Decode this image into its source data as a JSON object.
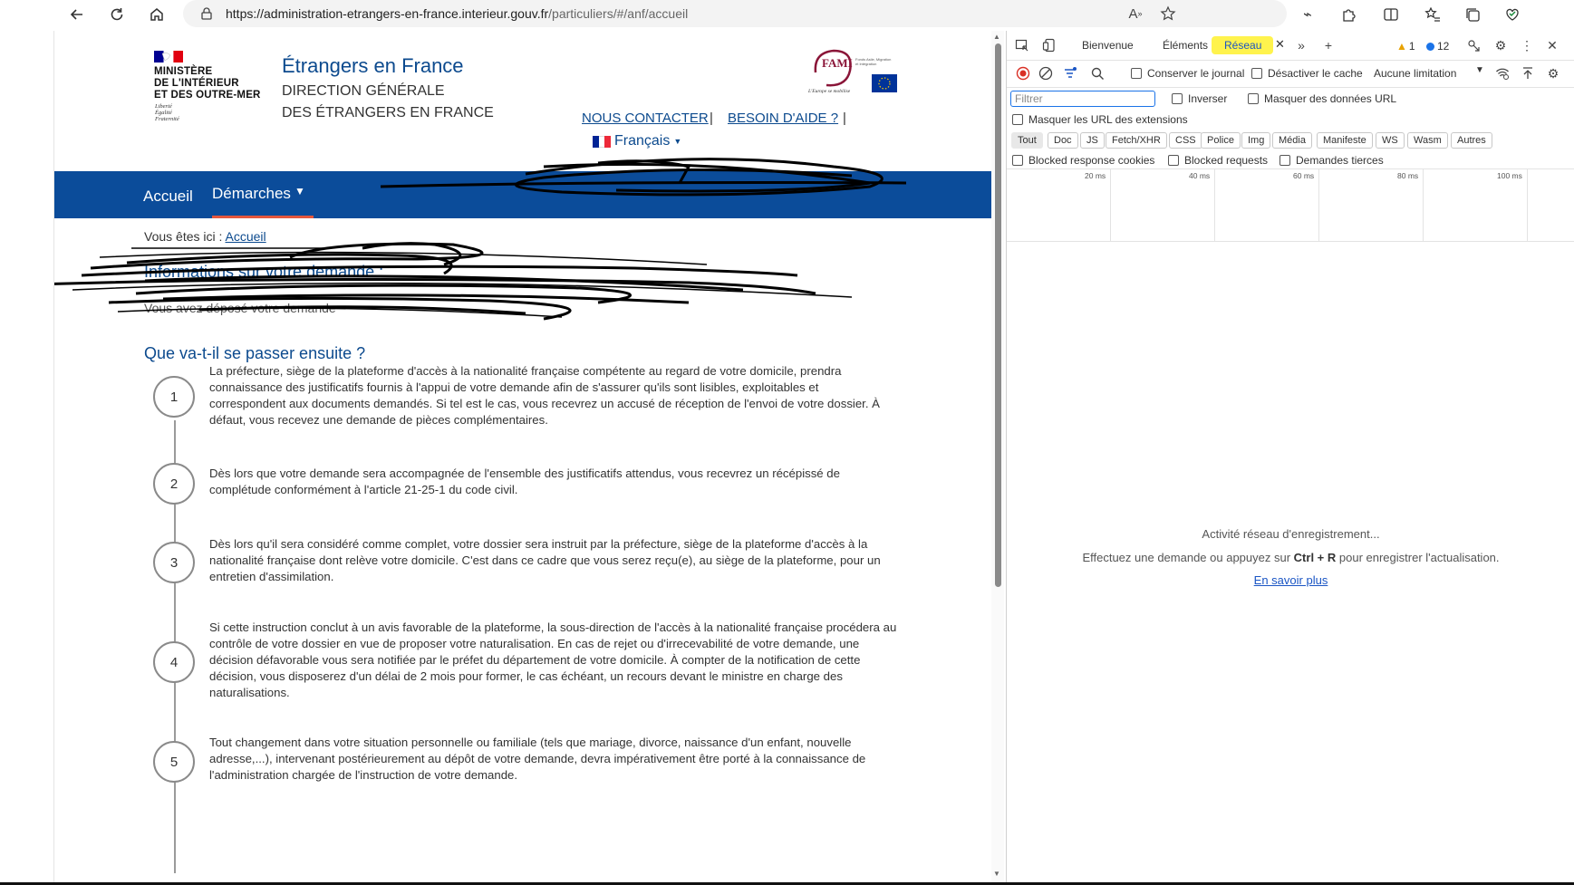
{
  "browser": {
    "url_host": "https://administration-etrangers-en-france.interieur.gouv.fr",
    "url_path": "/particuliers/#/anf/accueil"
  },
  "site": {
    "ministry_lines": [
      "MINISTÈRE",
      "DE L'INTÉRIEUR",
      "ET DES OUTRE-MER"
    ],
    "devise_lines": [
      "Liberté",
      "Égalité",
      "Fraternité"
    ],
    "title": "Étrangers en France",
    "subtitle_1": "DIRECTION GÉNÉRALE",
    "subtitle_2": "DES ÉTRANGERS EN FRANCE",
    "fami_logo_text": "FAMI",
    "fami_logo_small": "Fonds Asile, Migration et Intégration",
    "fami_logo_tagline": "L'Europe se mobilise",
    "contact_label": "NOUS CONTACTER",
    "help_label": "BESOIN D'AIDE ?",
    "separator": "|",
    "language": "Français"
  },
  "nav": {
    "home": "Accueil",
    "demarches": "Démarches"
  },
  "breadcrumb": {
    "prefix": "Vous êtes ici :",
    "current": "Accueil"
  },
  "main": {
    "info_heading": "Informations sur votre demande :",
    "info_text": "Vous avez déposé votre demande",
    "next_heading": "Que va-t-il se passer ensuite ?",
    "steps": [
      {
        "num": "1",
        "text": "La préfecture, siège de la plateforme d'accès à la nationalité française compétente au regard de votre domicile, prendra connaissance des justificatifs fournis à l'appui de votre demande afin de s'assurer qu'ils sont lisibles, exploitables et correspondent aux documents demandés. Si tel est le cas, vous recevrez un accusé de réception de l'envoi de votre dossier. À défaut, vous recevez une demande de pièces complémentaires."
      },
      {
        "num": "2",
        "text": "Dès lors que votre demande sera accompagnée de l'ensemble des justificatifs attendus, vous recevrez un récépissé de complétude conformément à l'article 21-25-1 du code civil."
      },
      {
        "num": "3",
        "text": "Dès lors qu'il sera considéré comme complet, votre dossier sera instruit par la préfecture, siège de la plateforme d'accès à la nationalité française dont relève votre domicile. C'est dans ce cadre que vous serez reçu(e), au siège de la plateforme, pour un entretien d'assimilation."
      },
      {
        "num": "4",
        "text": "Si cette instruction conclut à un avis favorable de la plateforme, la sous-direction de l'accès à la nationalité française procédera au contrôle de votre dossier en vue de proposer votre naturalisation. En cas de rejet ou d'irrecevabilité de votre demande, une décision défavorable vous sera notifiée par le préfet du département de votre domicile. À compter de la notification de cette décision, vous disposerez d'un délai de 2 mois pour former, le cas échéant, un recours devant le ministre en charge des naturalisations."
      },
      {
        "num": "5",
        "text": "Tout changement dans votre situation personnelle ou familiale (tels que mariage, divorce, naissance d'un enfant, nouvelle adresse,...), intervenant postérieurement au dépôt de votre demande, devra impérativement être porté à la connaissance de l'administration chargée de l'instruction de votre demande."
      }
    ]
  },
  "devtools": {
    "tabs": {
      "welcome": "Bienvenue",
      "elements": "Éléments",
      "network": "Réseau"
    },
    "warnings": "1",
    "messages": "12",
    "preserve_log": "Conserver le journal",
    "disable_cache": "Désactiver le cache",
    "throttling": "Aucune limitation",
    "filter_placeholder": "Filtrer",
    "invert": "Inverser",
    "hide_data_urls": "Masquer des données URL",
    "hide_extension_urls": "Masquer les URL des extensions",
    "types": [
      "Tout",
      "Doc",
      "JS",
      "Fetch/XHR",
      "CSS",
      "Police",
      "Img",
      "Média",
      "Manifeste",
      "WS",
      "Wasm",
      "Autres"
    ],
    "blocked_cookies": "Blocked response cookies",
    "blocked_requests": "Blocked requests",
    "third_party": "Demandes tierces",
    "timeline_labels": [
      "20 ms",
      "40 ms",
      "60 ms",
      "80 ms",
      "100 ms"
    ],
    "empty_title": "Activité réseau d'enregistrement...",
    "empty_hint_prefix": "Effectuez une demande ou appuyez sur",
    "empty_hint_keys": "Ctrl + R",
    "empty_hint_suffix": "pour enregistrer l'actualisation.",
    "learn_more": "En savoir plus"
  },
  "colors": {
    "brand_blue": "#0b4c9a",
    "accent_red": "#e4573d",
    "devtools_highlight": "#fff34d"
  }
}
